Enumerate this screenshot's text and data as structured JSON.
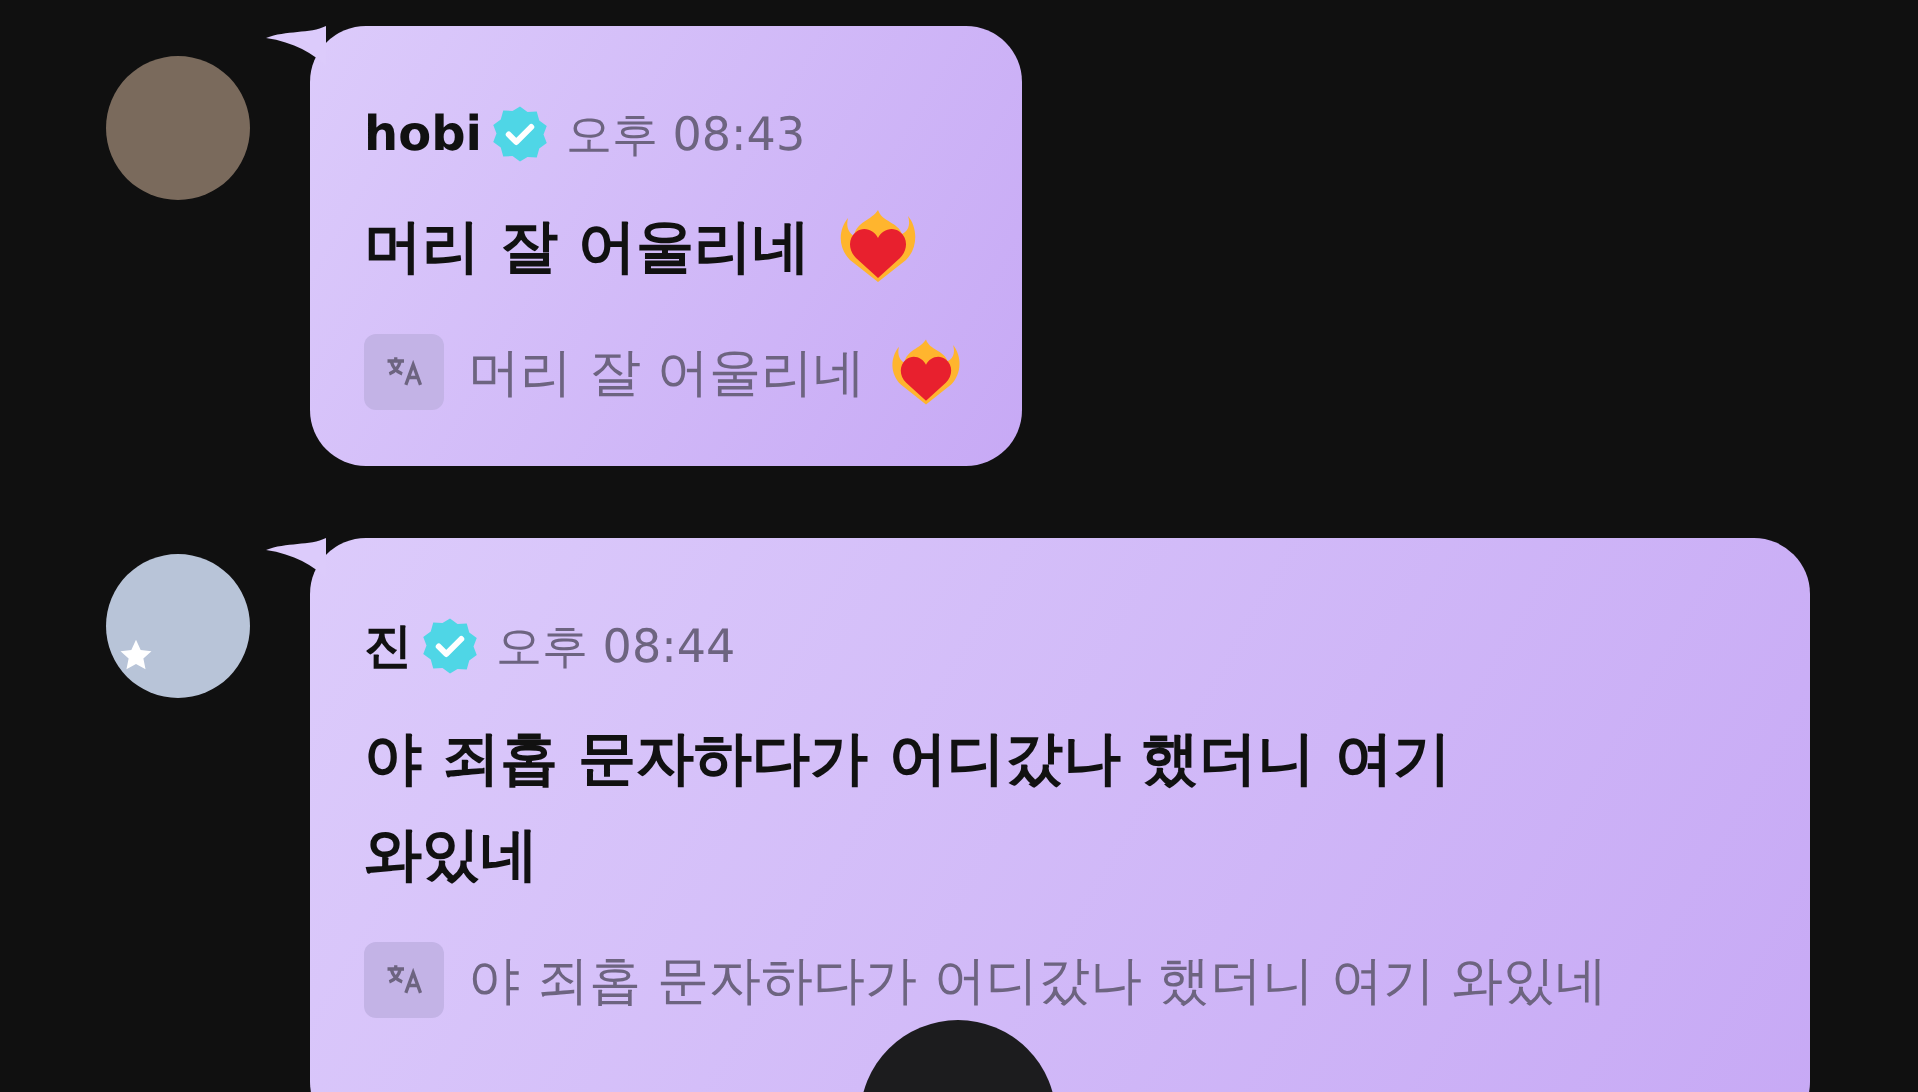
{
  "messages": [
    {
      "sender": "hobi",
      "verified": true,
      "time": "오후 08:43",
      "text": "머리 잘 어울리네",
      "fire_heart": true,
      "translation": "머리 잘 어울리네",
      "avatar_star": false
    },
    {
      "sender": "진",
      "verified": true,
      "time": "오후 08:44",
      "text": "야 죄홉 문자하다가 어디갔나 했더니 여기 와있네",
      "fire_heart": false,
      "translation": "야 죄홉 문자하다가 어디갔나 했더니 여기 와있네",
      "avatar_star": true
    }
  ]
}
